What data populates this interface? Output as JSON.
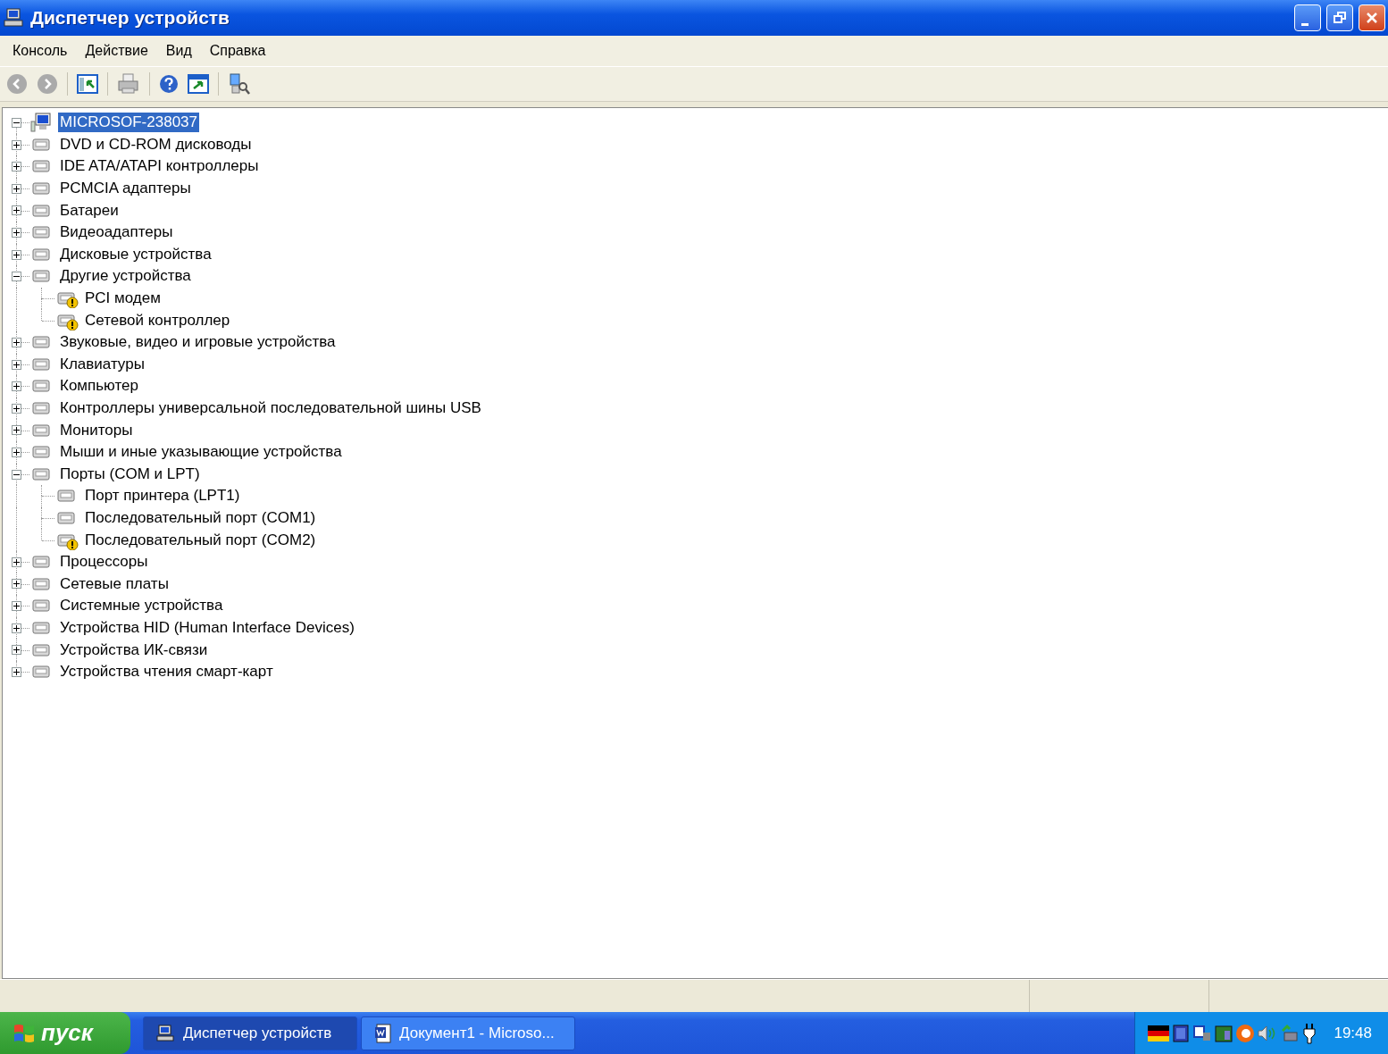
{
  "window": {
    "title": "Диспетчер устройств"
  },
  "menu": [
    "Консоль",
    "Действие",
    "Вид",
    "Справка"
  ],
  "tree": {
    "label": "MICROSOF-238037",
    "expanded": true,
    "selected": true,
    "children": [
      {
        "label": "DVD и CD-ROM дисководы",
        "expanded": false,
        "selected": false,
        "warning": false
      },
      {
        "label": "IDE ATA/ATAPI контроллеры",
        "expanded": false,
        "selected": false,
        "warning": false
      },
      {
        "label": "PCMCIA адаптеры",
        "expanded": false,
        "selected": false,
        "warning": false
      },
      {
        "label": "Батареи",
        "expanded": false,
        "selected": false,
        "warning": false
      },
      {
        "label": "Видеоадаптеры",
        "expanded": false,
        "selected": false,
        "warning": false
      },
      {
        "label": "Дисковые устройства",
        "expanded": false,
        "selected": false,
        "warning": false
      },
      {
        "label": "Другие устройства",
        "expanded": true,
        "selected": false,
        "warning": false,
        "children": [
          {
            "label": "PCI модем",
            "selected": false,
            "warning": true
          },
          {
            "label": "Сетевой контроллер",
            "selected": false,
            "warning": true
          }
        ]
      },
      {
        "label": "Звуковые, видео и игровые устройства",
        "expanded": false,
        "selected": false,
        "warning": false
      },
      {
        "label": "Клавиатуры",
        "expanded": false,
        "selected": false,
        "warning": false
      },
      {
        "label": "Компьютер",
        "expanded": false,
        "selected": false,
        "warning": false
      },
      {
        "label": "Контроллеры универсальной последовательной шины USB",
        "expanded": false,
        "selected": false,
        "warning": false
      },
      {
        "label": "Мониторы",
        "expanded": false,
        "selected": false,
        "warning": false
      },
      {
        "label": "Мыши и иные указывающие устройства",
        "expanded": false,
        "selected": false,
        "warning": false
      },
      {
        "label": "Порты (COM и LPT)",
        "expanded": true,
        "selected": false,
        "warning": false,
        "children": [
          {
            "label": "Порт принтера (LPT1)",
            "selected": false,
            "warning": false
          },
          {
            "label": "Последовательный порт (COM1)",
            "selected": false,
            "warning": false
          },
          {
            "label": "Последовательный порт (COM2)",
            "selected": false,
            "warning": true
          }
        ]
      },
      {
        "label": "Процессоры",
        "expanded": false,
        "selected": false,
        "warning": false
      },
      {
        "label": "Сетевые платы",
        "expanded": false,
        "selected": false,
        "warning": false
      },
      {
        "label": "Системные устройства",
        "expanded": false,
        "selected": false,
        "warning": false
      },
      {
        "label": "Устройства HID (Human Interface Devices)",
        "expanded": false,
        "selected": false,
        "warning": false
      },
      {
        "label": "Устройства ИК-связи",
        "expanded": false,
        "selected": false,
        "warning": false
      },
      {
        "label": "Устройства чтения смарт-карт",
        "expanded": false,
        "selected": false,
        "warning": false
      }
    ]
  },
  "taskbar": {
    "start": "пуск",
    "tasks": [
      {
        "label": "Диспетчер устройств",
        "selected": true
      },
      {
        "label": "Документ1 - Microso...",
        "selected": false
      }
    ],
    "clock": "19:48"
  }
}
